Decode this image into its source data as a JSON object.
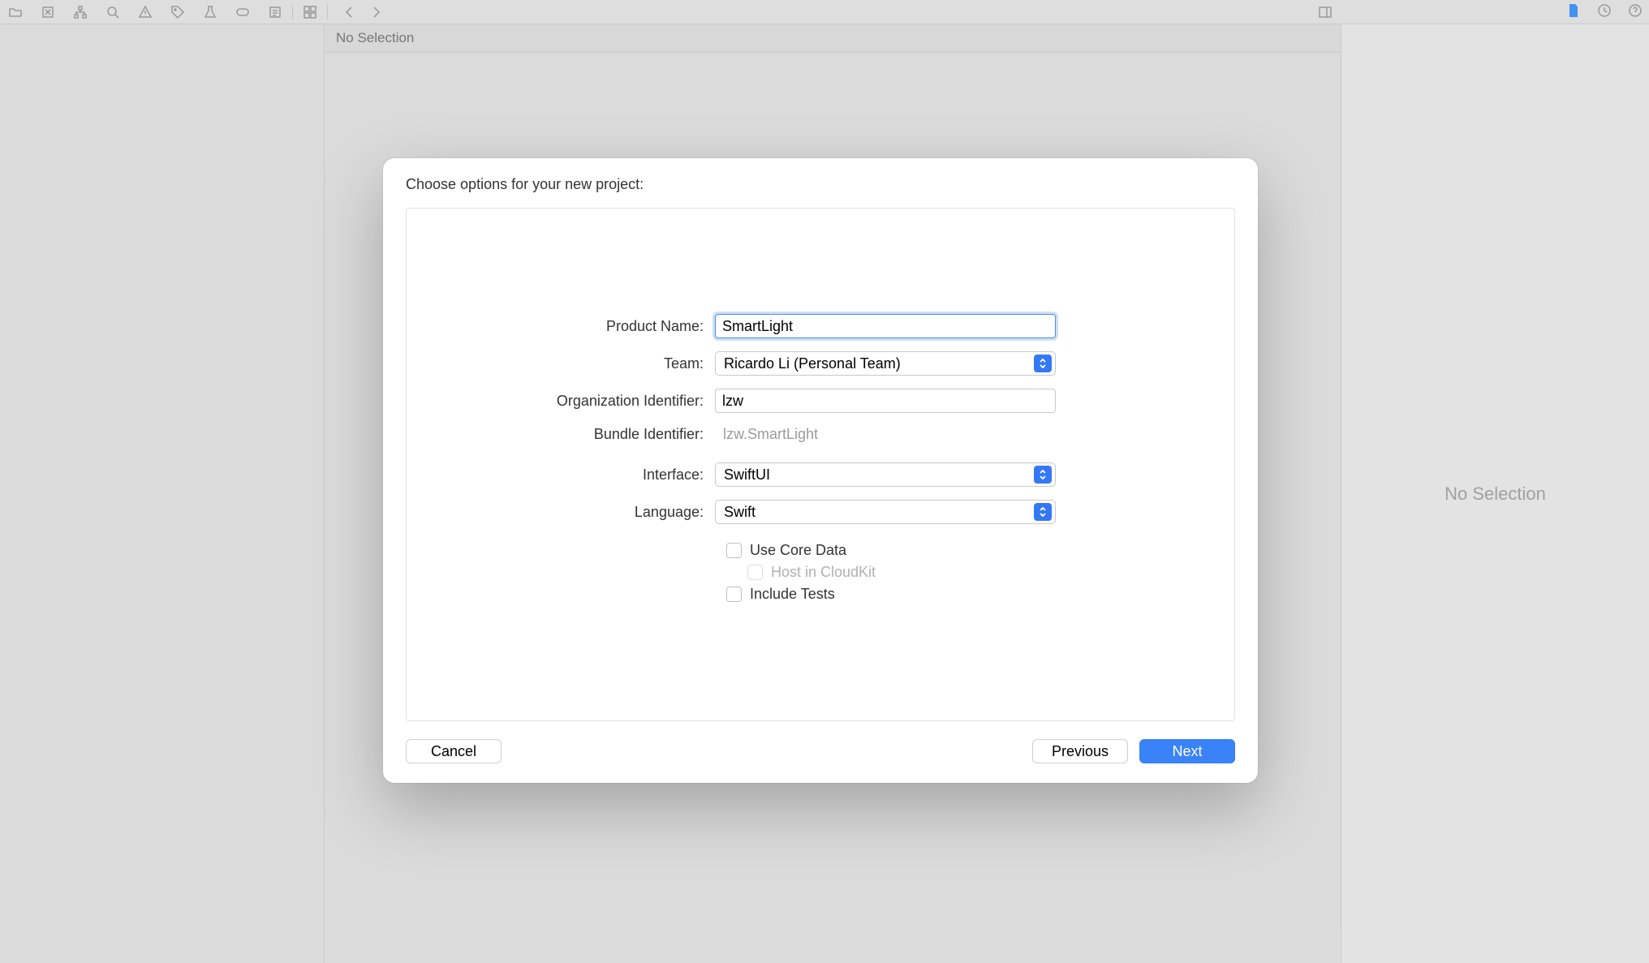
{
  "center_header": "No Selection",
  "right_panel_text": "No Selection",
  "modal": {
    "title": "Choose options for your new project:",
    "fields": {
      "product_name_label": "Product Name:",
      "product_name_value": "SmartLight",
      "team_label": "Team:",
      "team_value": "Ricardo Li (Personal Team)",
      "org_id_label": "Organization Identifier:",
      "org_id_value": "lzw",
      "bundle_id_label": "Bundle Identifier:",
      "bundle_id_value": "lzw.SmartLight",
      "interface_label": "Interface:",
      "interface_value": "SwiftUI",
      "language_label": "Language:",
      "language_value": "Swift",
      "use_core_data_label": "Use Core Data",
      "host_cloudkit_label": "Host in CloudKit",
      "include_tests_label": "Include Tests"
    },
    "buttons": {
      "cancel": "Cancel",
      "previous": "Previous",
      "next": "Next"
    }
  }
}
